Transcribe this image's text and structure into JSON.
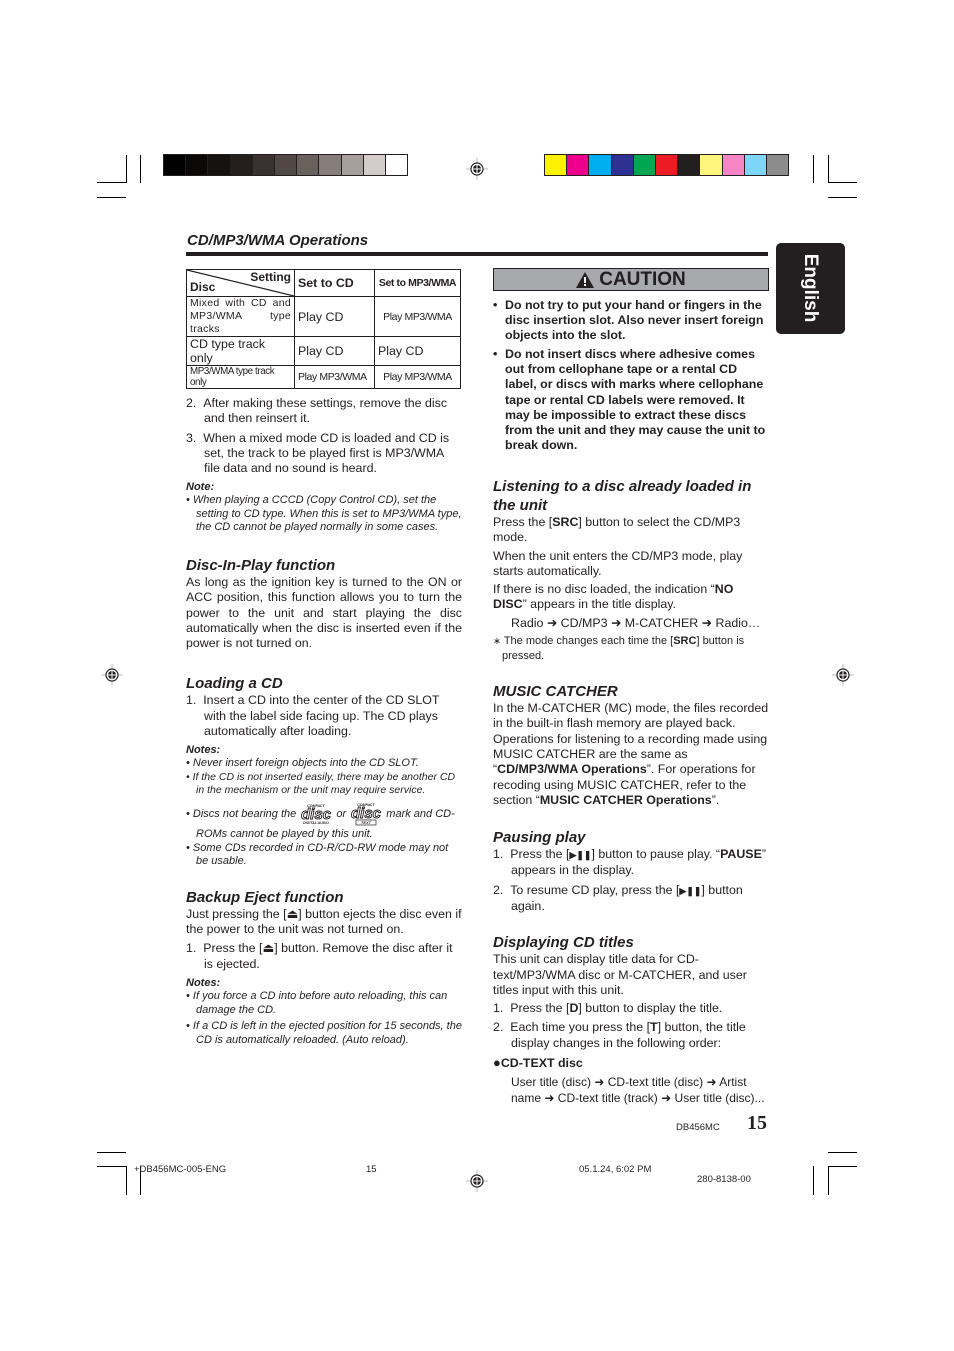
{
  "print_marks": {
    "gray_swatches": [
      "#000000",
      "#0a0908",
      "#141210",
      "#241f1c",
      "#3a3230",
      "#514845",
      "#6a605c",
      "#877d7a",
      "#a79f9c",
      "#d4cccb",
      "#ffffff"
    ],
    "color_swatches": [
      "#fff200",
      "#ec008c",
      "#00aeef",
      "#2e3192",
      "#00a651",
      "#ed1c24",
      "#231f20",
      "#fff57d",
      "#f784c5",
      "#7dd6f7",
      "#8c8c8c"
    ]
  },
  "side_tab": {
    "label": "English"
  },
  "section_title": "CD/MP3/WMA Operations",
  "settings_table": {
    "corner_top": "Setting",
    "corner_bottom": "Disc",
    "col_headers": [
      "Set to CD",
      "Set to MP3/WMA"
    ],
    "rows": [
      {
        "disc": "Mixed with CD and MP3/WMA type tracks",
        "cd": "Play CD",
        "mp3": "Play MP3/WMA"
      },
      {
        "disc": "CD type track only",
        "cd": "Play CD",
        "mp3": "Play CD"
      },
      {
        "disc": "MP3/WMA type track only",
        "cd": "Play MP3/WMA",
        "mp3": "Play MP3/WMA"
      }
    ]
  },
  "steps_after_table": [
    {
      "num": "2.",
      "text": "After making these settings, remove the disc and then reinsert it."
    },
    {
      "num": "3.",
      "text": "When a mixed mode CD is loaded and CD is set, the track to be played first is MP3/WMA file data and no sound is heard."
    }
  ],
  "note1": {
    "heading": "Note:",
    "items": [
      "When playing a CCCD (Copy Control CD), set the setting to CD type. When this is set to MP3/WMA type, the CD cannot be played normally in some cases."
    ]
  },
  "disc_in_play": {
    "heading": "Disc-In-Play function",
    "body": "As long as the ignition key is turned to the ON or ACC position, this function allows you to turn the power to the unit and start playing the disc automatically when the disc is inserted even if the power is not turned on."
  },
  "loading": {
    "heading": "Loading a CD",
    "steps": [
      {
        "num": "1.",
        "text": "Insert a CD into the center of the CD SLOT with the label side facing up. The CD plays automatically after loading."
      }
    ],
    "notes_heading": "Notes:",
    "notes": [
      "Never insert foreign objects into the CD SLOT.",
      "If the CD is not inserted easily, there may be another CD in the mechanism or the unit may require service."
    ],
    "logo_note_pre": "Discs not bearing the",
    "logo_note_or": "or",
    "logo_note_post": "mark and CD-ROMs cannot  be played by this unit.",
    "logo1": {
      "top": "COMPACT",
      "main": "disc",
      "bottom": "DIGITAL AUDIO"
    },
    "logo2": {
      "top": "COMPACT",
      "main": "disc",
      "bottom": "TEXT"
    },
    "last_note": "Some CDs recorded in CD-R/CD-RW mode may not be usable."
  },
  "backup_eject": {
    "heading": "Backup Eject function",
    "body_pre": "Just pressing the [",
    "body_post": "] button  ejects the disc even if the power to the unit was not turned on.",
    "step_num": "1.",
    "step_pre": "Press the [",
    "step_post": "] button. Remove the disc after it is ejected.",
    "notes_heading": "Notes:",
    "notes": [
      "If you force a CD into before auto reloading, this can damage the CD.",
      "If a CD is left in the ejected position for 15 seconds, the CD is automatically reloaded. (Auto reload)."
    ]
  },
  "caution": {
    "title": "CAUTION",
    "items": [
      "Do not try to put your hand or fingers in the disc insertion slot. Also never insert foreign objects into the slot.",
      "Do not insert discs where adhesive comes out from cellophane tape or a rental CD label, or discs with marks where cellophane tape or rental CD labels were removed. It may be impossible to extract these discs from the unit and they may cause the unit to break down."
    ]
  },
  "listening": {
    "heading": "Listening to a disc already loaded in the unit",
    "p1_pre": "Press the [",
    "p1_key": "SRC",
    "p1_post": "] button to select the CD/MP3 mode.",
    "p2": "When the unit enters the CD/MP3 mode, play starts automatically.",
    "p3_pre": "If there is no disc loaded, the indication “",
    "p3_key": "NO DISC",
    "p3_post": "” appears in the title display.",
    "flow": [
      "Radio",
      "CD/MP3",
      "M-CATCHER",
      "Radio…"
    ],
    "foot_pre": "The mode changes each time the [",
    "foot_key": "SRC",
    "foot_post": "] button is pressed."
  },
  "music_catcher": {
    "heading": "MUSIC CATCHER",
    "p_a": "In the M-CATCHER (MC) mode, the files recorded in the built-in flash memory are played back. Operations for listening to a recording made using MUSIC CATCHER are the same as “",
    "p_b": "CD/MP3/WMA Operations",
    "p_c": "”. For operations for recoding using MUSIC CATCHER, refer to the section “",
    "p_d": "MUSIC CATCHER Operations",
    "p_e": "”."
  },
  "pausing": {
    "heading": "Pausing play",
    "s1_num": "1.",
    "s1_pre": "Press the [",
    "s1_mid": "] button to pause play. “",
    "s1_key": "PAUSE",
    "s1_post": "” appears in the display.",
    "s2_num": "2.",
    "s2_pre": "To resume CD play, press the [",
    "s2_post": "] button again."
  },
  "displaying": {
    "heading": "Displaying CD titles",
    "body": "This unit can display title data for CD-text/MP3/WMA disc or M-CATCHER, and user titles input with this unit.",
    "s1_num": "1.",
    "s1_pre": "Press the [",
    "s1_key": "D",
    "s1_post": "] button to display the title.",
    "s2_num": "2.",
    "s2_pre": "Each time you press the [",
    "s2_key": "T",
    "s2_post": "] button, the title display changes in the following order:",
    "cdtext_label": "CD-TEXT disc",
    "order": [
      "User title (disc)",
      "CD-text title (disc)",
      "Artist name",
      "CD-text title (track)",
      "User title (disc)..."
    ]
  },
  "page_footer": {
    "model": "DB456MC",
    "page_number": "15"
  },
  "print_slug": {
    "file": "+DB456MC-005-ENG",
    "page": "15",
    "datetime": "05.1.24, 6:02 PM",
    "part_no": "280-8138-00"
  }
}
